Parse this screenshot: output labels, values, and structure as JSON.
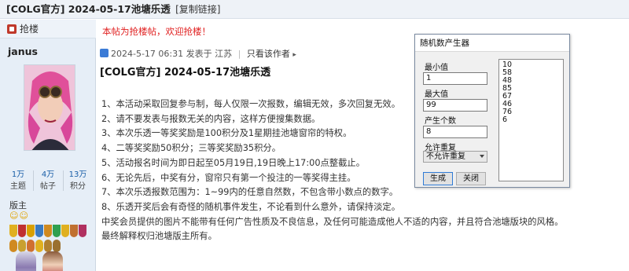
{
  "thread": {
    "title": "[COLG官方] 2024-05-17池塘乐透",
    "copy_link": "[复制链接]"
  },
  "sidebar": {
    "grab_floor_label": "抢楼",
    "username": "janus",
    "stats": [
      {
        "value": "1万",
        "label": "主题"
      },
      {
        "value": "4万",
        "label": "帖子"
      },
      {
        "value": "13万",
        "label": "积分"
      }
    ],
    "group_label": "版主",
    "smileys": "☺☺"
  },
  "post": {
    "notice": "本帖为抢楼帖，欢迎抢楼！",
    "date": "2024-5-17 06:31",
    "posted_from": "发表于 江苏",
    "author_only": "只看该作者",
    "title": "[COLG官方] 2024-05-17池塘乐透",
    "rules": [
      "1、本活动采取回复参与制，每人仅限一次报数，编辑无效，多次回复无效。",
      "2、请不要发表与报数无关的内容，这样方便搜集数据。",
      "3、本次乐透一等奖奖励是100积分及1星期挂池塘窗帘的特权。",
      "4、二等奖奖励50积分；三等奖奖励35积分。",
      "5、活动报名时间为即日起至05月19日,19日晚上17:00点整截止。",
      "6、无论先后，中奖有分，窗帘只有第一个投注的一等奖得主挂。",
      "7、本次乐透报数范围为：1~99内的任意自然数，不包含带小数点的数字。",
      "8、乐透开奖后会有奇怪的随机事件发生，不论看到什么意外，请保持淡定。",
      "中奖会员提供的图片不能带有任何广告性质及不良信息，及任何可能造成他人不适的内容，并且符合池塘版块的风格。",
      "最终解释权归池塘版主所有。"
    ]
  },
  "dialog": {
    "title": "随机数产生器",
    "min_label": "最小值",
    "min_value": "1",
    "max_label": "最大值",
    "max_value": "99",
    "count_label": "产生个数",
    "count_value": "8",
    "repeat_label": "允许重复",
    "repeat_value": "不允许重复",
    "generate_label": "生成",
    "close_label": "关闭",
    "results": [
      "10",
      "58",
      "48",
      "85",
      "67",
      "46",
      "76",
      "6"
    ]
  },
  "colors": {
    "notice_red": "#e02020",
    "link_blue": "#1a5fa8",
    "sidebar_bg": "#e6eef7"
  },
  "icons": [
    "thumbs-up-icon",
    "post-date-icon",
    "arrow-right-icon",
    "dropdown-arrow-icon"
  ]
}
